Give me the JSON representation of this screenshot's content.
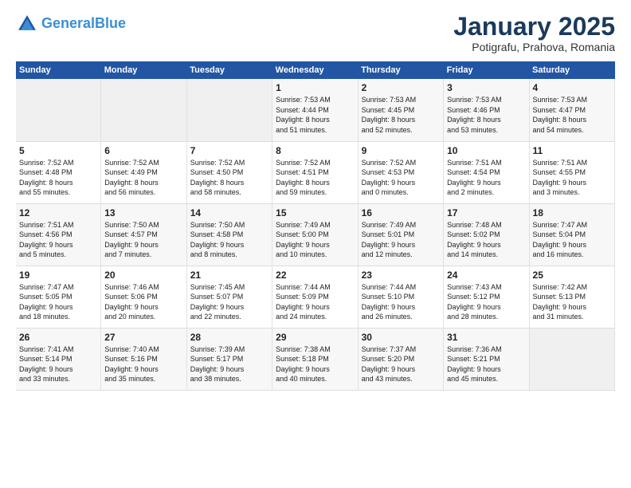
{
  "header": {
    "logo_line1": "General",
    "logo_line2": "Blue",
    "title": "January 2025",
    "subtitle": "Potigrafu, Prahova, Romania"
  },
  "days_of_week": [
    "Sunday",
    "Monday",
    "Tuesday",
    "Wednesday",
    "Thursday",
    "Friday",
    "Saturday"
  ],
  "weeks": [
    [
      {
        "day": "",
        "info": ""
      },
      {
        "day": "",
        "info": ""
      },
      {
        "day": "",
        "info": ""
      },
      {
        "day": "1",
        "info": "Sunrise: 7:53 AM\nSunset: 4:44 PM\nDaylight: 8 hours\nand 51 minutes."
      },
      {
        "day": "2",
        "info": "Sunrise: 7:53 AM\nSunset: 4:45 PM\nDaylight: 8 hours\nand 52 minutes."
      },
      {
        "day": "3",
        "info": "Sunrise: 7:53 AM\nSunset: 4:46 PM\nDaylight: 8 hours\nand 53 minutes."
      },
      {
        "day": "4",
        "info": "Sunrise: 7:53 AM\nSunset: 4:47 PM\nDaylight: 8 hours\nand 54 minutes."
      }
    ],
    [
      {
        "day": "5",
        "info": "Sunrise: 7:52 AM\nSunset: 4:48 PM\nDaylight: 8 hours\nand 55 minutes."
      },
      {
        "day": "6",
        "info": "Sunrise: 7:52 AM\nSunset: 4:49 PM\nDaylight: 8 hours\nand 56 minutes."
      },
      {
        "day": "7",
        "info": "Sunrise: 7:52 AM\nSunset: 4:50 PM\nDaylight: 8 hours\nand 58 minutes."
      },
      {
        "day": "8",
        "info": "Sunrise: 7:52 AM\nSunset: 4:51 PM\nDaylight: 8 hours\nand 59 minutes."
      },
      {
        "day": "9",
        "info": "Sunrise: 7:52 AM\nSunset: 4:53 PM\nDaylight: 9 hours\nand 0 minutes."
      },
      {
        "day": "10",
        "info": "Sunrise: 7:51 AM\nSunset: 4:54 PM\nDaylight: 9 hours\nand 2 minutes."
      },
      {
        "day": "11",
        "info": "Sunrise: 7:51 AM\nSunset: 4:55 PM\nDaylight: 9 hours\nand 3 minutes."
      }
    ],
    [
      {
        "day": "12",
        "info": "Sunrise: 7:51 AM\nSunset: 4:56 PM\nDaylight: 9 hours\nand 5 minutes."
      },
      {
        "day": "13",
        "info": "Sunrise: 7:50 AM\nSunset: 4:57 PM\nDaylight: 9 hours\nand 7 minutes."
      },
      {
        "day": "14",
        "info": "Sunrise: 7:50 AM\nSunset: 4:58 PM\nDaylight: 9 hours\nand 8 minutes."
      },
      {
        "day": "15",
        "info": "Sunrise: 7:49 AM\nSunset: 5:00 PM\nDaylight: 9 hours\nand 10 minutes."
      },
      {
        "day": "16",
        "info": "Sunrise: 7:49 AM\nSunset: 5:01 PM\nDaylight: 9 hours\nand 12 minutes."
      },
      {
        "day": "17",
        "info": "Sunrise: 7:48 AM\nSunset: 5:02 PM\nDaylight: 9 hours\nand 14 minutes."
      },
      {
        "day": "18",
        "info": "Sunrise: 7:47 AM\nSunset: 5:04 PM\nDaylight: 9 hours\nand 16 minutes."
      }
    ],
    [
      {
        "day": "19",
        "info": "Sunrise: 7:47 AM\nSunset: 5:05 PM\nDaylight: 9 hours\nand 18 minutes."
      },
      {
        "day": "20",
        "info": "Sunrise: 7:46 AM\nSunset: 5:06 PM\nDaylight: 9 hours\nand 20 minutes."
      },
      {
        "day": "21",
        "info": "Sunrise: 7:45 AM\nSunset: 5:07 PM\nDaylight: 9 hours\nand 22 minutes."
      },
      {
        "day": "22",
        "info": "Sunrise: 7:44 AM\nSunset: 5:09 PM\nDaylight: 9 hours\nand 24 minutes."
      },
      {
        "day": "23",
        "info": "Sunrise: 7:44 AM\nSunset: 5:10 PM\nDaylight: 9 hours\nand 26 minutes."
      },
      {
        "day": "24",
        "info": "Sunrise: 7:43 AM\nSunset: 5:12 PM\nDaylight: 9 hours\nand 28 minutes."
      },
      {
        "day": "25",
        "info": "Sunrise: 7:42 AM\nSunset: 5:13 PM\nDaylight: 9 hours\nand 31 minutes."
      }
    ],
    [
      {
        "day": "26",
        "info": "Sunrise: 7:41 AM\nSunset: 5:14 PM\nDaylight: 9 hours\nand 33 minutes."
      },
      {
        "day": "27",
        "info": "Sunrise: 7:40 AM\nSunset: 5:16 PM\nDaylight: 9 hours\nand 35 minutes."
      },
      {
        "day": "28",
        "info": "Sunrise: 7:39 AM\nSunset: 5:17 PM\nDaylight: 9 hours\nand 38 minutes."
      },
      {
        "day": "29",
        "info": "Sunrise: 7:38 AM\nSunset: 5:18 PM\nDaylight: 9 hours\nand 40 minutes."
      },
      {
        "day": "30",
        "info": "Sunrise: 7:37 AM\nSunset: 5:20 PM\nDaylight: 9 hours\nand 43 minutes."
      },
      {
        "day": "31",
        "info": "Sunrise: 7:36 AM\nSunset: 5:21 PM\nDaylight: 9 hours\nand 45 minutes."
      },
      {
        "day": "",
        "info": ""
      }
    ]
  ]
}
